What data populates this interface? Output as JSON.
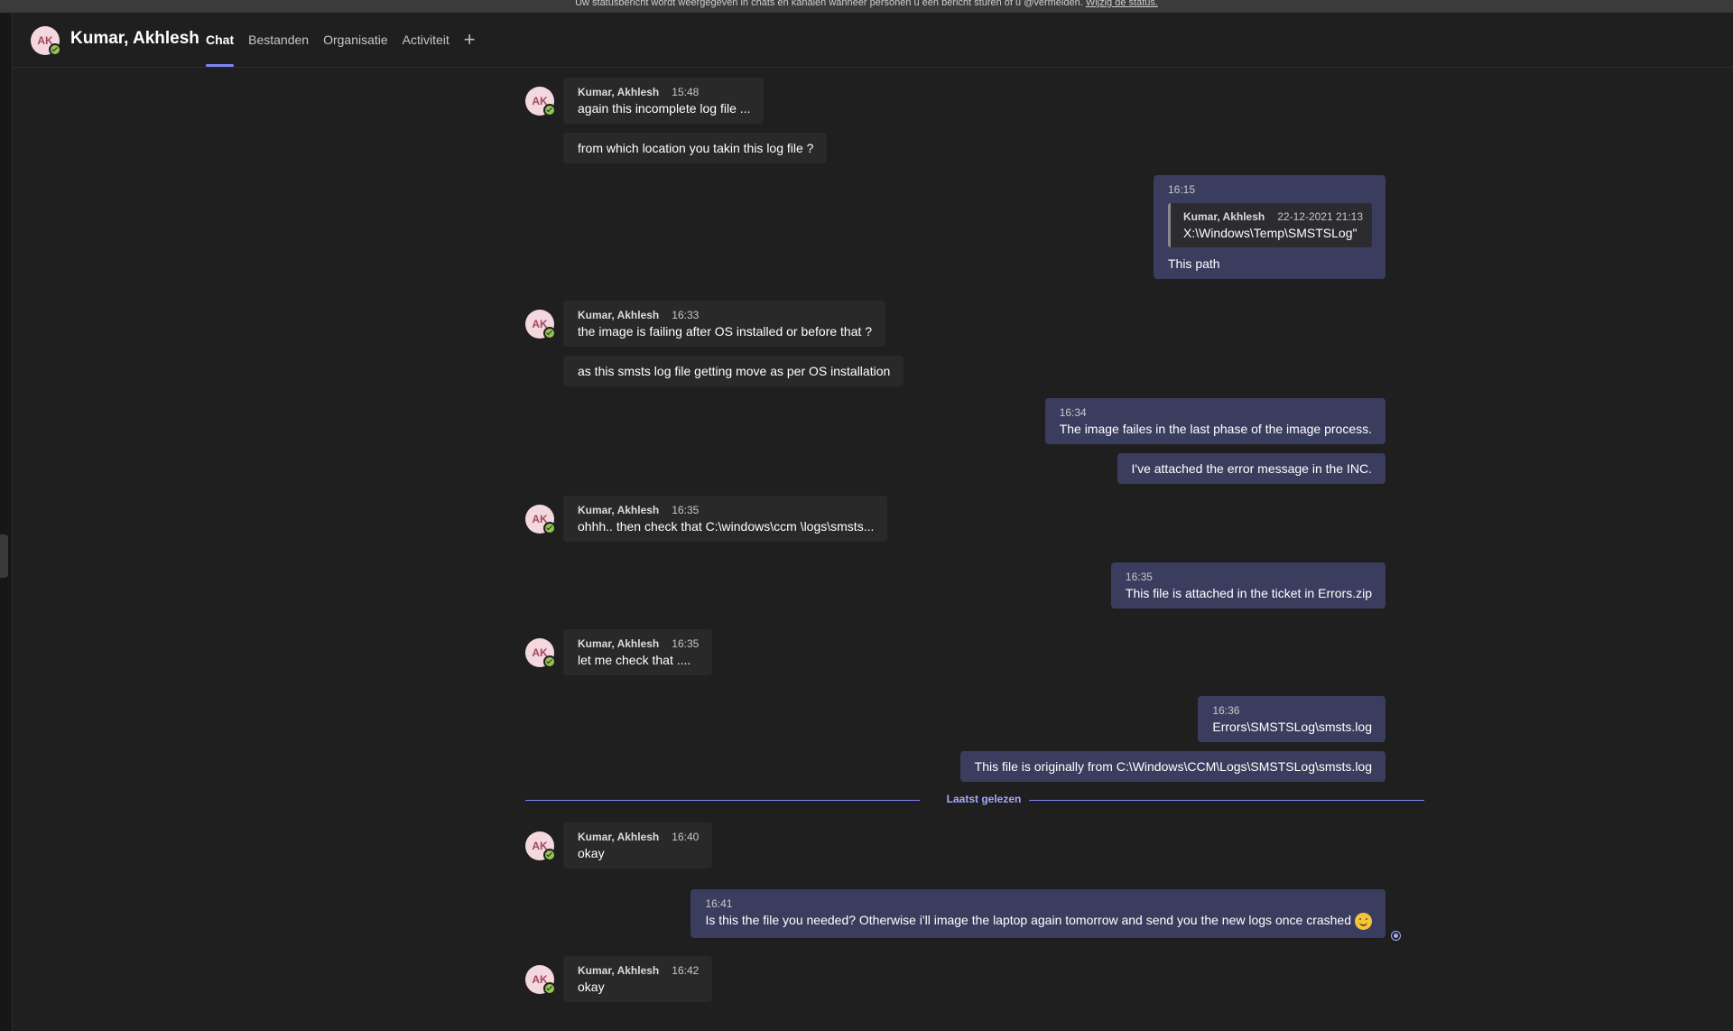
{
  "banner": {
    "text": "Uw statusbericht wordt weergegeven in chats en kanalen wanneer personen u een bericht sturen of u @vermelden.",
    "link": "Wijzig de status."
  },
  "header": {
    "initials": "AK",
    "name": "Kumar, Akhlesh",
    "tabs": [
      "Chat",
      "Bestanden",
      "Organisatie",
      "Activiteit"
    ],
    "add_tab": "+"
  },
  "messages": {
    "m1": {
      "sender": "Kumar, Akhlesh",
      "time": "15:48",
      "text": "again this incomplete log file ...",
      "cont": "from which location you takin this log file ?"
    },
    "m2": {
      "time": "16:15",
      "quote_sender": "Kumar, Akhlesh",
      "quote_time": "22-12-2021 21:13",
      "quote_text": "X:\\Windows\\Temp\\SMSTSLog\"",
      "text": "This path"
    },
    "m3": {
      "sender": "Kumar, Akhlesh",
      "time": "16:33",
      "text": "the image is failing after OS installed or before that ?",
      "cont": "as this smsts log file getting move as per OS installation"
    },
    "m4": {
      "time": "16:34",
      "text": "The image failes in the last phase of the image process.",
      "cont": "I've attached the error message in the INC."
    },
    "m5": {
      "sender": "Kumar, Akhlesh",
      "time": "16:35",
      "text": "ohhh.. then check that C:\\windows\\ccm \\logs\\smsts..."
    },
    "m6": {
      "time": "16:35",
      "text": "This file is attached in the ticket in Errors.zip"
    },
    "m7": {
      "sender": "Kumar, Akhlesh",
      "time": "16:35",
      "text": "let me check that ...."
    },
    "m8": {
      "time": "16:36",
      "text": "Errors\\SMSTSLog\\smsts.log",
      "cont": "This file is originally from C:\\Windows\\CCM\\Logs\\SMSTSLog\\smsts.log"
    },
    "divider": "Laatst gelezen",
    "m9": {
      "sender": "Kumar, Akhlesh",
      "time": "16:40",
      "text": "okay"
    },
    "m10": {
      "time": "16:41",
      "text": "Is this the file you needed? Otherwise i'll image the laptop again tomorrow and send you the new logs once crashed",
      "emoji": "smiley-emoji"
    },
    "m11": {
      "sender": "Kumar, Akhlesh",
      "time": "16:42",
      "text": "okay"
    }
  },
  "colors": {
    "background": "#1f1f1f",
    "incoming_bubble": "#292929",
    "outgoing_bubble": "#3b3d5e",
    "accent": "#7f85f5",
    "presence": "#92c353"
  }
}
